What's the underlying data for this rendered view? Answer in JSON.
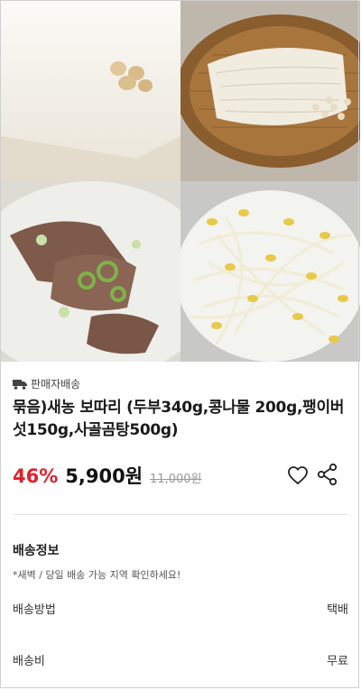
{
  "product": {
    "delivery_badge": "판매자배송",
    "title": "묶음)새농 보따리 (두부340g,콩나물 200g,팽이버섯150g,사골곰탕500g)",
    "discount": "46%",
    "price": "5,900원",
    "original_price": "11,000원"
  },
  "images": [
    "tofu",
    "enoki-mushroom",
    "bone-soup",
    "bean-sprouts"
  ],
  "shipping": {
    "section_title": "배송정보",
    "notice": "*새벽 / 당일 배송 가능 지역 확인하세요!",
    "rows": [
      {
        "label": "배송방법",
        "value": "택배"
      },
      {
        "label": "배송비",
        "value": "무료"
      }
    ]
  },
  "colors": {
    "discount": "#e0212f",
    "text": "#1a1a1a",
    "muted": "#999999"
  }
}
